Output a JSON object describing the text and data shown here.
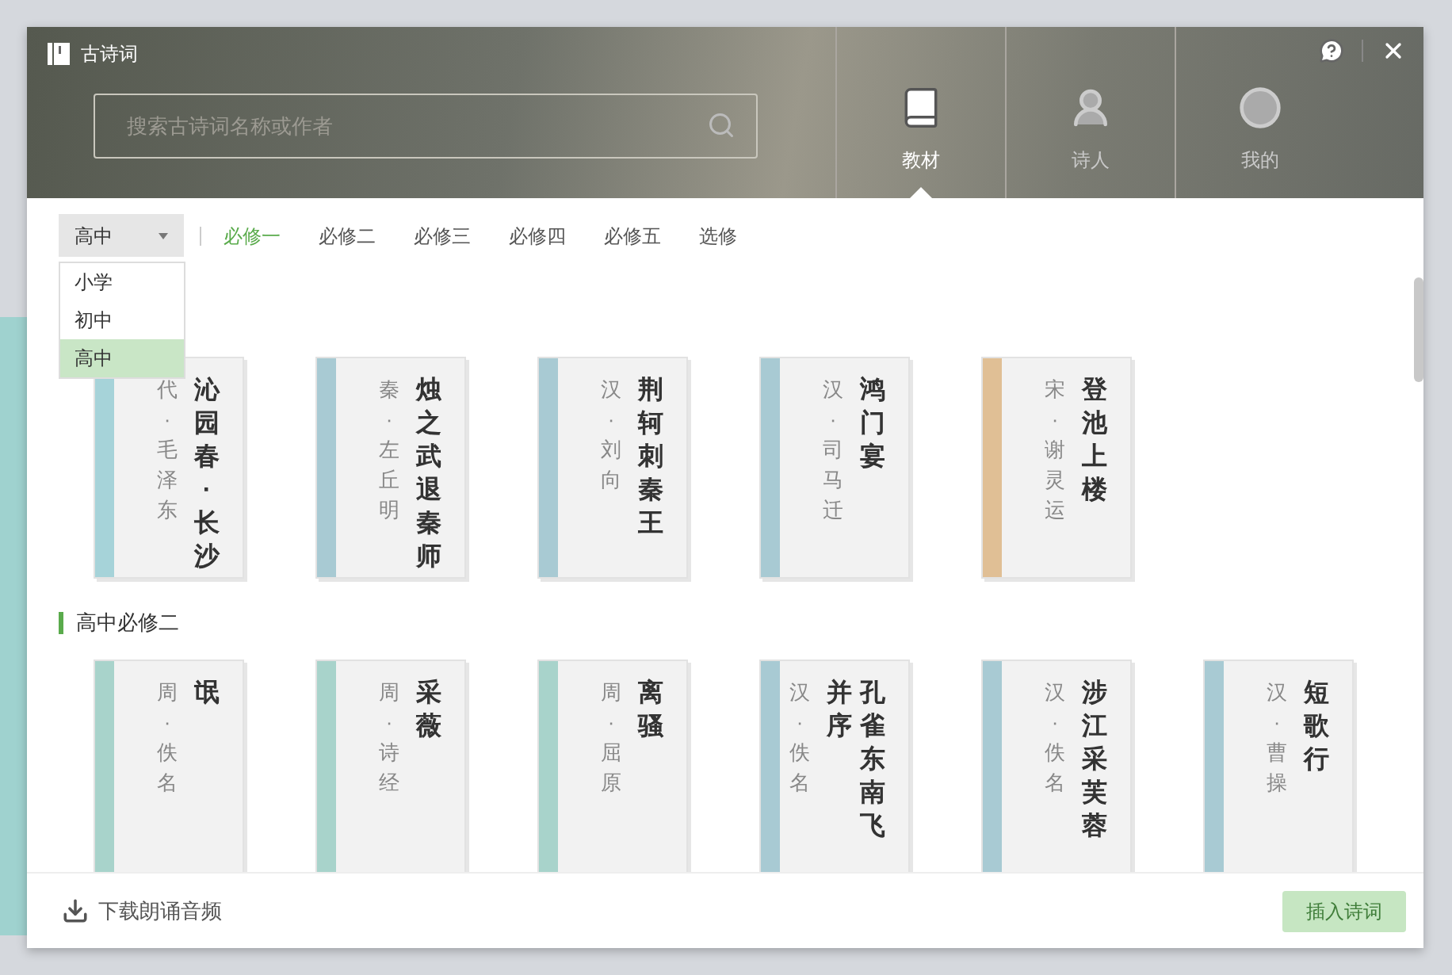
{
  "window": {
    "title": "古诗词"
  },
  "search": {
    "placeholder": "搜索古诗词名称或作者"
  },
  "nav_tabs": [
    {
      "label": "教材",
      "selected": true
    },
    {
      "label": "诗人",
      "selected": false
    },
    {
      "label": "我的",
      "selected": false
    }
  ],
  "level_select": {
    "value": "高中",
    "expanded": true,
    "options": [
      {
        "label": "小学",
        "selected": false
      },
      {
        "label": "初中",
        "selected": false
      },
      {
        "label": "高中",
        "selected": true
      }
    ]
  },
  "volume_tabs": [
    {
      "label": "必修一",
      "selected": true
    },
    {
      "label": "必修二",
      "selected": false
    },
    {
      "label": "必修三",
      "selected": false
    },
    {
      "label": "必修四",
      "selected": false
    },
    {
      "label": "必修五",
      "selected": false
    },
    {
      "label": "选修",
      "selected": false
    }
  ],
  "sections": [
    {
      "cards": [
        {
          "title": "沁园春·长沙",
          "author": "代·毛泽东",
          "color": "#a6d3d9"
        },
        {
          "title": "烛之武退秦师",
          "author": "秦·左丘明",
          "color": "#a8cad3"
        },
        {
          "title": "荆轲刺秦王",
          "author": "汉·刘向",
          "color": "#a8cad3"
        },
        {
          "title": "鸿门宴",
          "author": "汉·司马迁",
          "color": "#a8cad3"
        },
        {
          "title": "登池上楼",
          "author": "宋·谢灵运",
          "color": "#e0bf95"
        }
      ]
    },
    {
      "heading": "高中必修二",
      "cards": [
        {
          "title": "氓",
          "author": "周·佚名",
          "color": "#a8d3cb"
        },
        {
          "title": "采薇",
          "author": "周·诗经",
          "color": "#a8d3cb"
        },
        {
          "title": "离骚",
          "author": "周·屈原",
          "color": "#a8d3cb"
        },
        {
          "title": "孔雀东南飞并序",
          "author": "汉·佚名",
          "color": "#a8cad3"
        },
        {
          "title": "涉江采芙蓉",
          "author": "汉·佚名",
          "color": "#a8cad3"
        },
        {
          "title": "短歌行",
          "author": "汉·曹操",
          "color": "#a8cad3"
        }
      ]
    }
  ],
  "footer": {
    "download_link": "下载朗诵音频",
    "insert_button": "插入诗词"
  }
}
